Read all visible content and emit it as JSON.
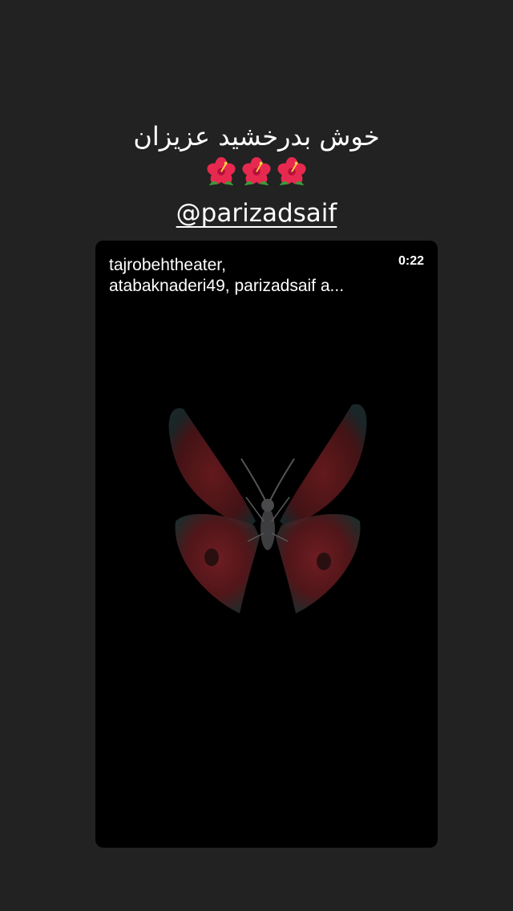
{
  "story": {
    "caption_text": "خوش بدرخشید عزیزان",
    "flowers": [
      "hibiscus-icon",
      "hibiscus-icon",
      "hibiscus-icon"
    ],
    "mention": "@parizadsaif"
  },
  "reel": {
    "title_line1": "tajrobehtheater,",
    "title_line2": "atabaknaderi49, parizadsaif a...",
    "duration": "0:22"
  },
  "colors": {
    "background": "#222222",
    "card_background": "#000000",
    "text": "#ffffff",
    "flower_petal": "#e8294f",
    "wing_red": "#6e1c1f"
  }
}
